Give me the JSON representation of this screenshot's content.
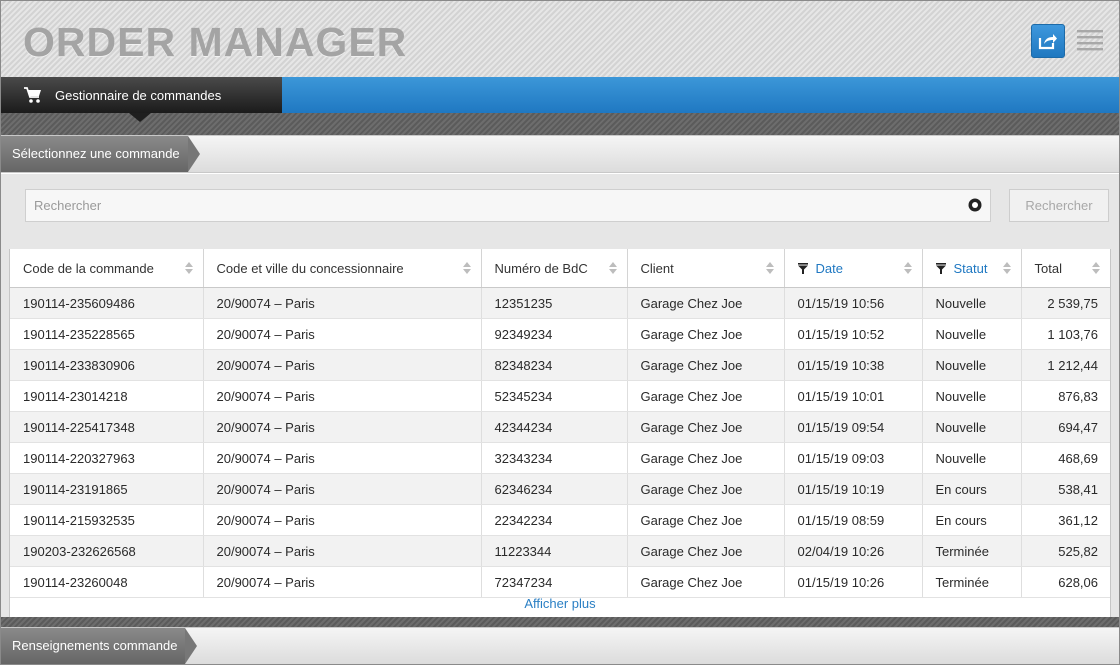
{
  "header": {
    "app_title": "ORDER MANAGER",
    "share_icon": "share-icon",
    "menu_icon": "hamburger-menu-icon"
  },
  "nav": {
    "active_tab_label": "Gestionnaire de commandes",
    "tab_icon": "shopping-cart-icon"
  },
  "section_select": {
    "title": "Sélectionnez une commande"
  },
  "search": {
    "placeholder": "Rechercher",
    "value": "",
    "button_label": "Rechercher"
  },
  "table": {
    "columns": [
      {
        "label": "Code de la commande",
        "filtered": false
      },
      {
        "label": "Code et ville du concessionnaire",
        "filtered": false
      },
      {
        "label": "Numéro de BdC",
        "filtered": false
      },
      {
        "label": "Client",
        "filtered": false
      },
      {
        "label": "Date",
        "filtered": true
      },
      {
        "label": "Statut",
        "filtered": true
      },
      {
        "label": "Total",
        "filtered": false
      }
    ],
    "rows": [
      [
        "190114-235609486",
        "20/90074 – Paris",
        "12351235",
        "Garage Chez Joe",
        "01/15/19 10:56",
        "Nouvelle",
        "2 539,75"
      ],
      [
        "190114-235228565",
        "20/90074 – Paris",
        "92349234",
        "Garage Chez Joe",
        "01/15/19 10:52",
        "Nouvelle",
        "1 103,76"
      ],
      [
        "190114-233830906",
        "20/90074 – Paris",
        "82348234",
        "Garage Chez Joe",
        "01/15/19 10:38",
        "Nouvelle",
        "1 212,44"
      ],
      [
        "190114-23014218",
        "20/90074 – Paris",
        "52345234",
        "Garage Chez Joe",
        "01/15/19 10:01",
        "Nouvelle",
        "876,83"
      ],
      [
        "190114-225417348",
        "20/90074 – Paris",
        "42344234",
        "Garage Chez Joe",
        "01/15/19 09:54",
        "Nouvelle",
        "694,47"
      ],
      [
        "190114-220327963",
        "20/90074 – Paris",
        "32343234",
        "Garage Chez Joe",
        "01/15/19 09:03",
        "Nouvelle",
        "468,69"
      ],
      [
        "190114-23191865",
        "20/90074 – Paris",
        "62346234",
        "Garage Chez Joe",
        "01/15/19 10:19",
        "En cours",
        "538,41"
      ],
      [
        "190114-215932535",
        "20/90074 – Paris",
        "22342234",
        "Garage Chez Joe",
        "01/15/19 08:59",
        "En cours",
        "361,12"
      ],
      [
        "190203-232626568",
        "20/90074 – Paris",
        "11223344",
        "Garage Chez Joe",
        "02/04/19 10:26",
        "Terminée",
        "525,82"
      ],
      [
        "190114-23260048",
        "20/90074 – Paris",
        "72347234",
        "Garage Chez Joe",
        "01/15/19 10:26",
        "Terminée",
        "628,06"
      ]
    ],
    "show_more_label": "Afficher plus"
  },
  "section_details": {
    "title": "Renseignements commande"
  },
  "colors": {
    "accent_blue": "#1f78c2",
    "nav_dark": "#1b1b1b",
    "title_grey": "#a4a4a4",
    "link_blue": "#2a7fc4"
  }
}
